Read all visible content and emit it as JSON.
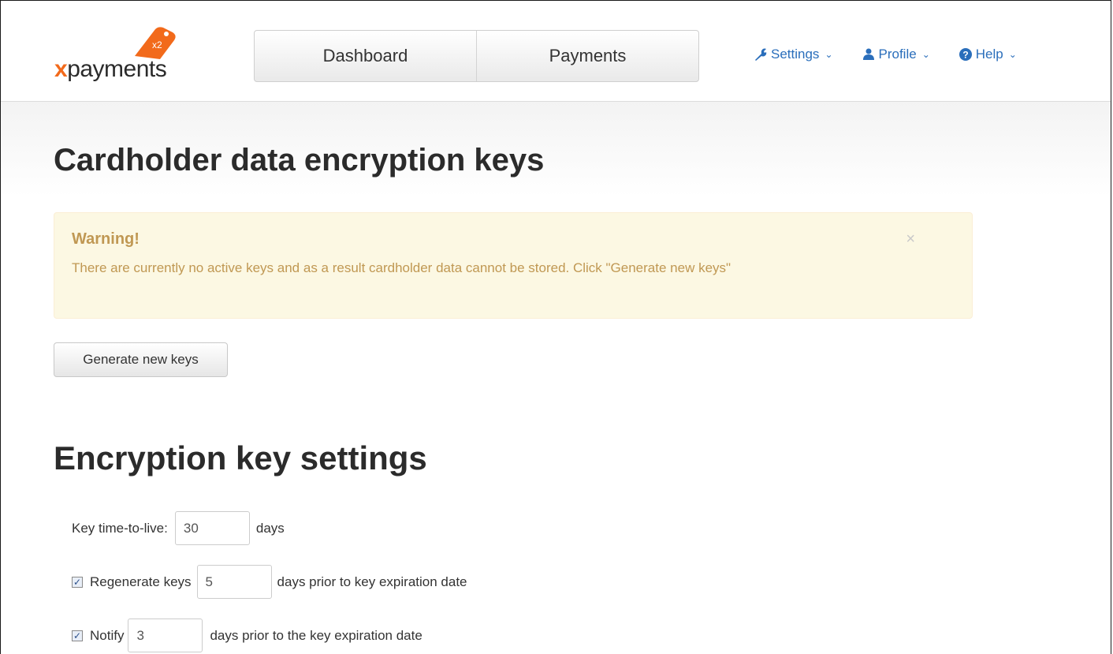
{
  "logo": {
    "x": "x",
    "text": "payments",
    "tag": "x2"
  },
  "nav": {
    "tabs": [
      {
        "label": "Dashboard"
      },
      {
        "label": "Payments"
      }
    ]
  },
  "menu": [
    {
      "label": "Settings",
      "icon": "wrench-icon"
    },
    {
      "label": "Profile",
      "icon": "user-icon"
    },
    {
      "label": "Help",
      "icon": "question-icon"
    }
  ],
  "page": {
    "title": "Cardholder data encryption keys",
    "alert": {
      "title": "Warning!",
      "text": "There are currently no active keys and as a result cardholder data cannot be stored. Click \"Generate new keys\"",
      "close": "×"
    },
    "generate_label": "Generate new keys",
    "settings_title": "Encryption key settings",
    "ttl": {
      "label": "Key time-to-live:",
      "value": "30",
      "unit": "days"
    },
    "regen": {
      "checked": true,
      "label": "Regenerate keys",
      "value": "5",
      "suffix": "days prior to key expiration date"
    },
    "notify": {
      "checked": true,
      "label": "Notify",
      "value": "3",
      "suffix": "days prior to the key expiration date"
    }
  },
  "colors": {
    "accent": "#f26a1b",
    "link": "#2a6ebb",
    "warning_bg": "#fcf8e3",
    "warning_text": "#c09853"
  }
}
